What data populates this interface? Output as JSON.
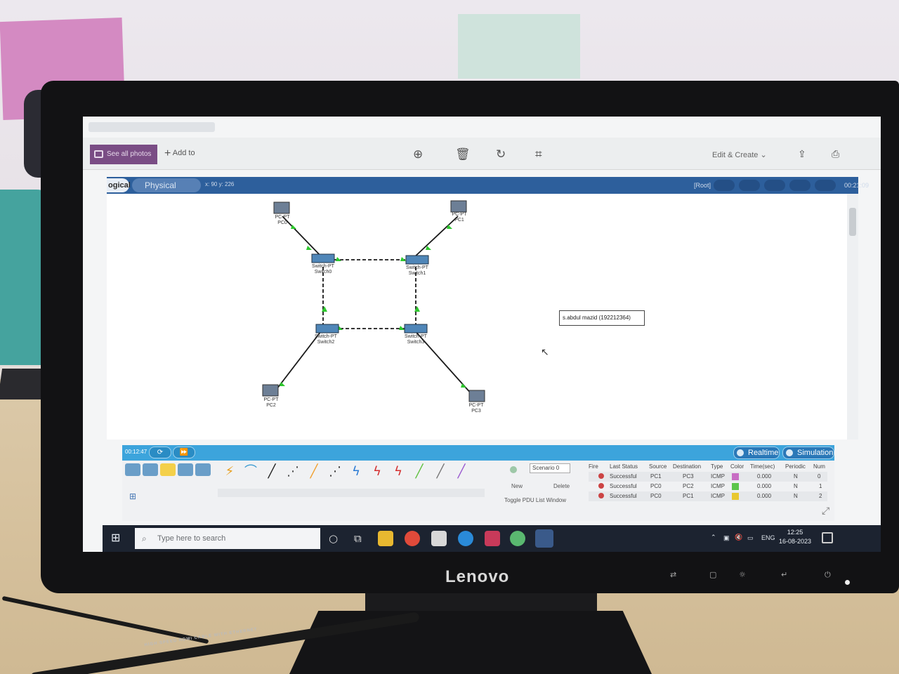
{
  "photos_app": {
    "see_all_label": "See all photos",
    "add_to_label": "Add to",
    "edit_create_label": "Edit & Create",
    "tools": [
      "zoom-icon",
      "delete-icon",
      "rotate-icon",
      "crop-icon"
    ]
  },
  "packet_tracer": {
    "tabs": {
      "logical": "ogical",
      "physical": "Physical"
    },
    "coords": "x: 90 y: 226",
    "root_label": "[Root]",
    "header_time": "00:21:09",
    "note_text": "s.abdul mazid (192212364)",
    "devices": [
      {
        "type": "PC-PT",
        "name": "PC0"
      },
      {
        "type": "PC-PT",
        "name": "PC1"
      },
      {
        "type": "PC-PT",
        "name": "PC2"
      },
      {
        "type": "PC-PT",
        "name": "PC3"
      },
      {
        "type": "Switch-PT",
        "name": "Switch0"
      },
      {
        "type": "Switch-PT",
        "name": "Switch1"
      },
      {
        "type": "Switch-PT",
        "name": "Switch2"
      },
      {
        "type": "Switch-PT",
        "name": "Switch3"
      }
    ],
    "sim_bar": {
      "time": "00:12:47",
      "realtime_label": "Realtime",
      "simulation_label": "Simulation"
    },
    "scenario": {
      "selected": "Scenario 0",
      "new_label": "New",
      "delete_label": "Delete",
      "toggle_label": "Toggle PDU List Window"
    },
    "pdu_table": {
      "columns": [
        "Fire",
        "Last Status",
        "Source",
        "Destination",
        "Type",
        "Color",
        "Time(sec)",
        "Periodic",
        "Num"
      ],
      "rows": [
        {
          "status": "Successful",
          "source": "PC1",
          "destination": "PC3",
          "type": "ICMP",
          "color": "#c86ec4",
          "time": "0.000",
          "periodic": "N",
          "num": "0"
        },
        {
          "status": "Successful",
          "source": "PC0",
          "destination": "PC2",
          "type": "ICMP",
          "color": "#5cc64a",
          "time": "0.000",
          "periodic": "N",
          "num": "1"
        },
        {
          "status": "Successful",
          "source": "PC0",
          "destination": "PC1",
          "type": "ICMP",
          "color": "#e8c830",
          "time": "0.000",
          "periodic": "N",
          "num": "2"
        }
      ]
    }
  },
  "taskbar": {
    "search_placeholder": "Type here to search",
    "language": "ENG",
    "time": "12:25",
    "date": "16-08-2023"
  },
  "monitor": {
    "brand": "Lenovo"
  },
  "cable_text": "HIGH SPEED HDMI CABLE WITH ETHERNET"
}
